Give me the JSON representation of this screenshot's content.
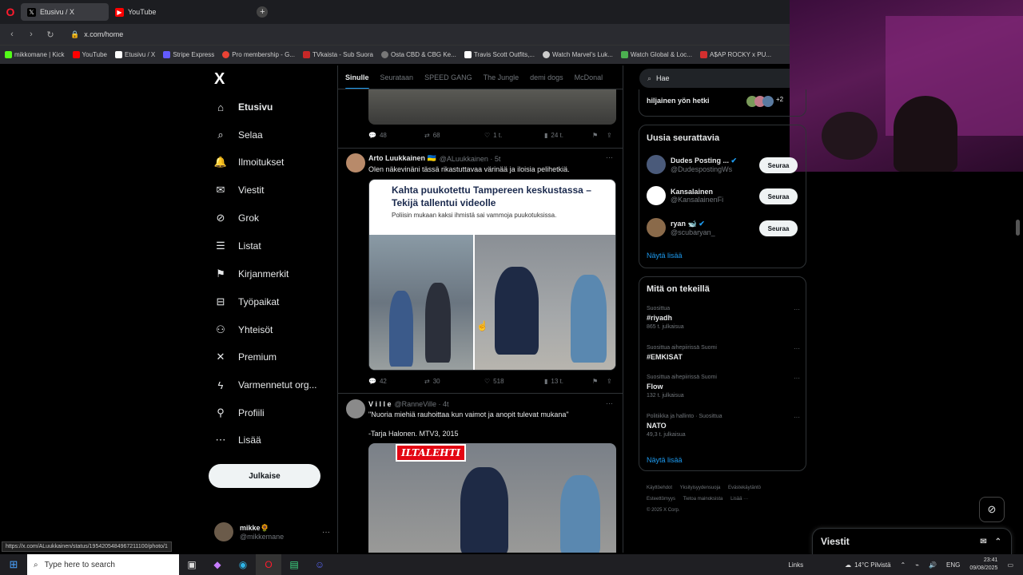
{
  "browser": {
    "tabs": [
      {
        "label": "Etusivu / X",
        "active": true
      },
      {
        "label": "YouTube",
        "active": false
      }
    ],
    "new_tab": "+",
    "url": "x.com/home",
    "bookmarks": [
      {
        "label": "mikkomane | Kick",
        "color": "#53fc18"
      },
      {
        "label": "YouTube",
        "color": "#ff0000"
      },
      {
        "label": "Etusivu / X",
        "color": "#ffffff"
      },
      {
        "label": "Stripe Express",
        "color": "#635bff"
      },
      {
        "label": "Pro membership - G...",
        "color": "#ea4335"
      },
      {
        "label": "TVkaista - Sub Suora",
        "color": "#c62828"
      },
      {
        "label": "Osta CBD & CBG Ke...",
        "color": "#777777"
      },
      {
        "label": "Travis Scott Outfits,...",
        "color": "#ffffff"
      },
      {
        "label": "Watch Marvel's Luk...",
        "color": "#cccccc"
      },
      {
        "label": "Watch Global & Loc...",
        "color": "#4caf50"
      },
      {
        "label": "A$AP ROCKY x PU...",
        "color": "#d32f2f"
      }
    ]
  },
  "nav": {
    "logo": "X",
    "items": [
      {
        "label": "Etusivu",
        "icon": "⌂"
      },
      {
        "label": "Selaa",
        "icon": "⌕"
      },
      {
        "label": "Ilmoitukset",
        "icon": "🔔"
      },
      {
        "label": "Viestit",
        "icon": "✉"
      },
      {
        "label": "Grok",
        "icon": "⊘"
      },
      {
        "label": "Listat",
        "icon": "☰"
      },
      {
        "label": "Kirjanmerkit",
        "icon": "⚑"
      },
      {
        "label": "Työpaikat",
        "icon": "⊟"
      },
      {
        "label": "Yhteisöt",
        "icon": "⚇"
      },
      {
        "label": "Premium",
        "icon": "✕"
      },
      {
        "label": "Varmennetut org...",
        "icon": "ϟ"
      },
      {
        "label": "Profiili",
        "icon": "⚲"
      },
      {
        "label": "Lisää",
        "icon": "⋯"
      }
    ],
    "post_button": "Julkaise",
    "account": {
      "name": "mikke🌻",
      "handle": "@mikkemane",
      "more": "···"
    }
  },
  "feed": {
    "tabs": [
      "Sinulle",
      "Seurataan",
      "SPEED GANG",
      "The Jungle",
      "demi dogs",
      "McDonal"
    ],
    "tweet0_actions": {
      "replies": "48",
      "retweets": "68",
      "likes": "1 t.",
      "views": "24 t."
    },
    "tweet1": {
      "name": "Arto Luukkainen 🇺🇦",
      "meta": "@ALuukkainen · 5t",
      "text": "Olen näkevinäni tässä rikastuttavaa värinää ja iloisia pelihetkiä.",
      "card_headline": "Kahta puukotettu Tampereen keskustassa – Tekijä tallentui videolle",
      "card_sub": "Poliisin mukaan kaksi ihmistä sai vammoja puukotuksissa.",
      "actions": {
        "replies": "42",
        "retweets": "30",
        "likes": "518",
        "views": "13 t."
      }
    },
    "tweet2": {
      "name": "V i l l e",
      "meta": "@RanneVille · 4t",
      "text1": "\"Nuoria miehiä rauhoittaa kun vaimot ja anopit tulevat mukana\"",
      "text2": "-Tarja Halonen. MTV3, 2015",
      "video_logo": "ILTALEHTI"
    },
    "more": "···"
  },
  "right": {
    "search_placeholder": "Hae",
    "top_partial": {
      "text": "hiljainen yön hetki",
      "count": "+2"
    },
    "who_to_follow": {
      "title": "Uusia seurattavia",
      "items": [
        {
          "name": "Dudes Posting ...",
          "handle": "@DudespostingWs",
          "button": "Seuraa"
        },
        {
          "name": "Kansalainen",
          "handle": "@KansalainenFi",
          "button": "Seuraa"
        },
        {
          "name": "ryan 🐋",
          "handle": "@scubaryan_",
          "button": "Seuraa"
        }
      ],
      "show_more": "Näytä lisää"
    },
    "trends": {
      "title": "Mitä on tekeillä",
      "items": [
        {
          "context": "Suosittua",
          "title": "#riyadh",
          "count": "865 t. julkaisua"
        },
        {
          "context": "Suosittua aihepiirissä Suomi",
          "title": "#EMKISAT",
          "count": ""
        },
        {
          "context": "Suosittua aihepiirissä Suomi",
          "title": "Flow",
          "count": "132 t. julkaisua"
        },
        {
          "context": "Politiikka ja hallinto · Suosittua",
          "title": "NATO",
          "count": "49,3 t. julkaisua"
        }
      ],
      "show_more": "Näytä lisää"
    },
    "footer": [
      "Käyttöehdot",
      "Yksityisyydensuoja",
      "Evästekäytäntö",
      "Esteettömyys",
      "Tietoa mainoksista",
      "Lisää ···",
      "© 2025 X Corp."
    ]
  },
  "messages_drawer": {
    "title": "Viestit"
  },
  "status_url": "https://x.com/ALuukkainen/status/1954205484967211100/photo/1",
  "taskbar": {
    "search_placeholder": "Type here to search",
    "links": "Links",
    "weather": "14°C Pilvistä",
    "lang": "ENG",
    "time": "23:41",
    "date": "09/08/2025"
  }
}
